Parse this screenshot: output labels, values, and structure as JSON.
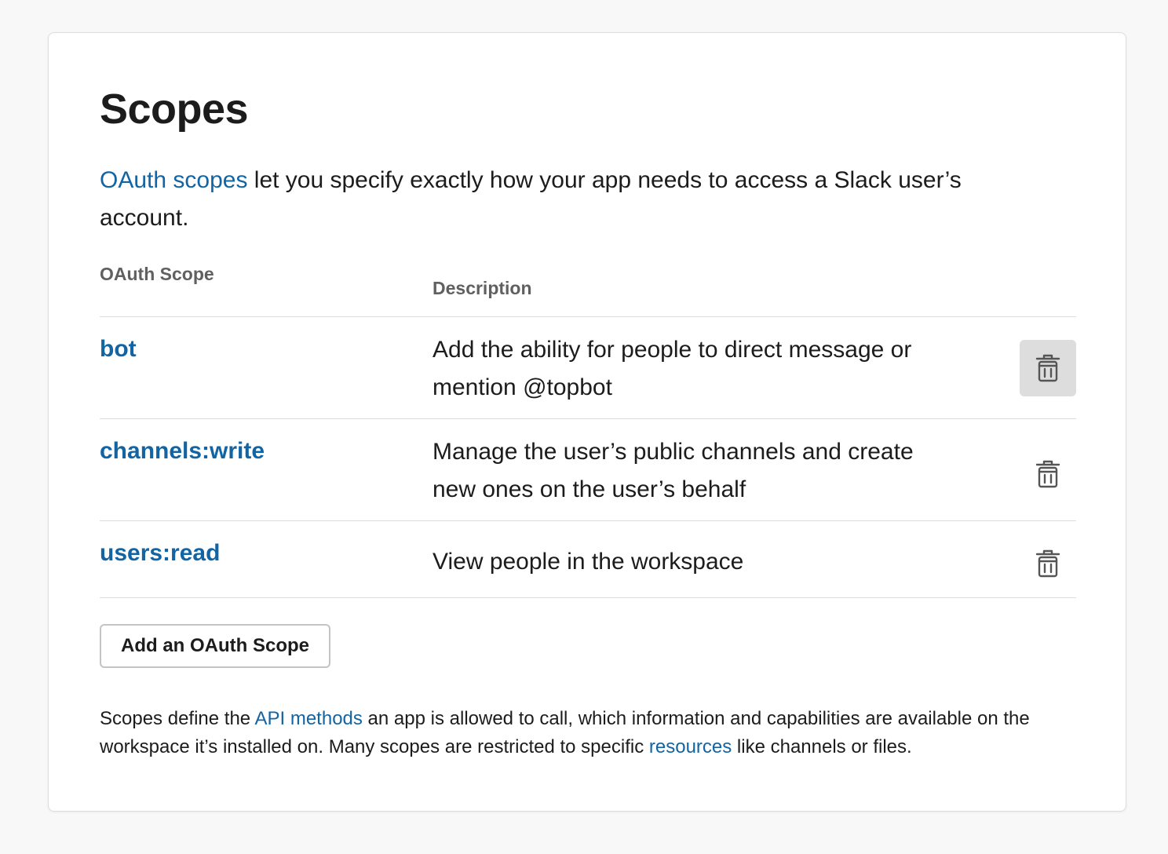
{
  "section": {
    "title": "Scopes",
    "intro_link": "OAuth scopes",
    "intro_rest": " let you specify exactly how your app needs to access a Slack user’s account."
  },
  "table": {
    "headers": {
      "scope": "OAuth Scope",
      "description": "Description"
    },
    "rows": [
      {
        "scope": "bot",
        "description": "Add the ability for people to direct message or mention @topbot",
        "delete_icon": "trash-icon"
      },
      {
        "scope": "channels:write",
        "description": "Manage the user’s public channels and create new ones on the user’s behalf",
        "delete_icon": "trash-icon"
      },
      {
        "scope": "users:read",
        "description": "View people in the workspace",
        "delete_icon": "trash-icon"
      }
    ]
  },
  "actions": {
    "add_scope_label": "Add an OAuth Scope"
  },
  "footer": {
    "part1": "Scopes define the ",
    "link1": "API methods",
    "part2": " an app is allowed to call, which information and capabilities are available on the workspace it’s installed on. Many scopes are restricted to specific ",
    "link2": "resources",
    "part3": " like channels or files."
  },
  "colors": {
    "link": "#1264a3",
    "text": "#1d1c1d",
    "muted": "#616061",
    "border": "#dddddd"
  }
}
